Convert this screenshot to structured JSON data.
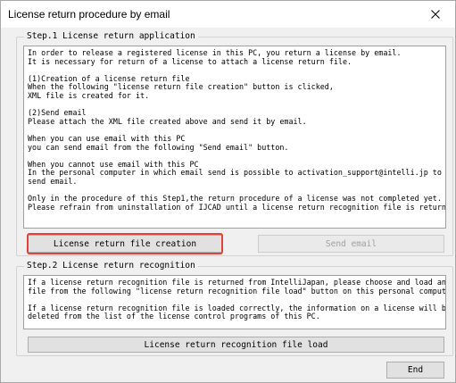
{
  "window": {
    "title": "License return procedure by email"
  },
  "step1": {
    "legend": "Step.1 License return application",
    "lines": [
      "In order to release a registered license in this PC, you return a license by email.",
      "It is necessary for return of a license to attach a license return file.",
      "",
      "(1)Creation of a license return file",
      "When the following \"license return file creation\" button is clicked,",
      "XML file is created for it.",
      "",
      "(2)Send email",
      "Please attach the XML file created above and send it by email.",
      "",
      "When you can use email with this PC",
      "you can send email from the following \"Send email\" button.",
      "",
      "When you cannot use email with this PC",
      "In the personal computer in which email send is possible to activation_support@intelli.jp to",
      "send email.",
      "",
      "Only in the procedure of this Step1,the return procedure of a license was not completed yet.",
      "Please refrain from uninstallation of IJCAD until a license return recognition file is returned."
    ],
    "create_button": "License return file creation",
    "send_button": "Send email"
  },
  "step2": {
    "legend": "Step.2 License return recognition",
    "lines": [
      "If a license return recognition file is returned from IntelliJapan, please choose and load an XML",
      "file from the following \"license return recognition file load\" button on this personal computer.",
      "",
      "If a license return recognition file is loaded correctly, the information on a license will be",
      "deleted from the list of the license control programs of this PC."
    ],
    "load_button": "License return recognition file load"
  },
  "footer": {
    "end_button": "End"
  },
  "colors": {
    "highlight": "#e0423c"
  }
}
